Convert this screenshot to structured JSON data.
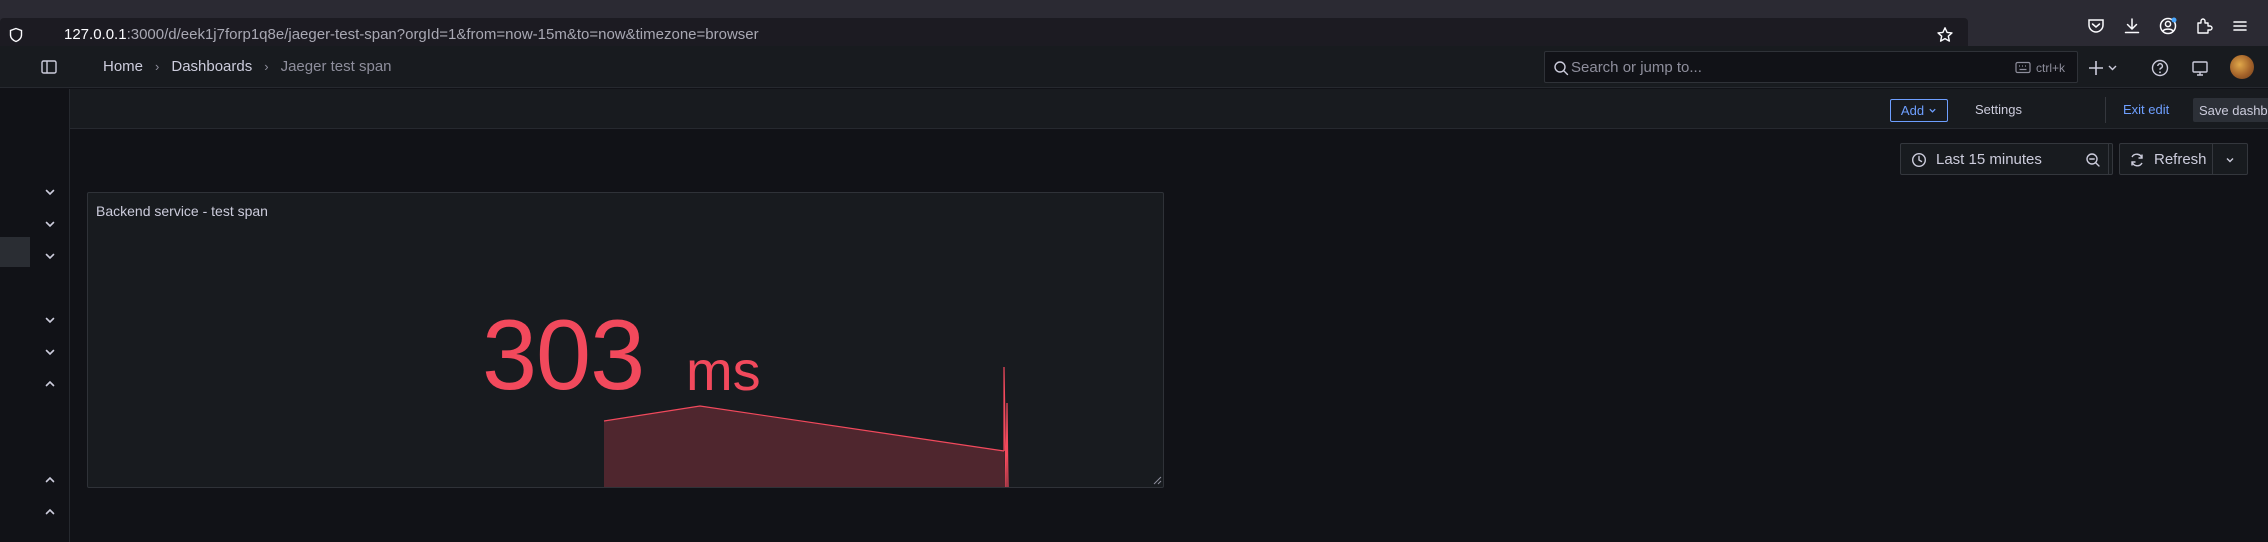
{
  "browser": {
    "url_host": "127.0.0.1",
    "url_rest": ":3000/d/eek1j7forp1q8e/jaeger-test-span?orgId=1&from=now-15m&to=now&timezone=browser"
  },
  "breadcrumb": {
    "home": "Home",
    "dashboards": "Dashboards",
    "current": "Jaeger test span"
  },
  "search": {
    "placeholder": "Search or jump to...",
    "shortcut": "ctrl+k"
  },
  "toolbar": {
    "add_label": "Add",
    "settings_label": "Settings",
    "exit_edit_label": "Exit edit",
    "save_label": "Save dashboard"
  },
  "controls": {
    "time_range": "Last 15 minutes",
    "refresh_label": "Refresh"
  },
  "panel": {
    "title": "Backend service - test span",
    "value": "303",
    "unit": "ms",
    "color": "#f2495c"
  },
  "colors": {
    "accent_blue": "#6e9fff",
    "stat_red": "#f2495c",
    "background": "#111217",
    "panel_bg": "#181b1f"
  },
  "icons": [
    "shield-icon",
    "star-icon",
    "pocket-icon",
    "download-icon",
    "account-icon",
    "extensions-icon",
    "menu-icon",
    "dock-menu-icon",
    "search-icon",
    "keyboard-icon",
    "plus-icon",
    "help-icon",
    "news-icon",
    "clock-icon",
    "zoom-out-icon",
    "refresh-icon",
    "chevron-down-icon",
    "chevron-up-icon"
  ]
}
